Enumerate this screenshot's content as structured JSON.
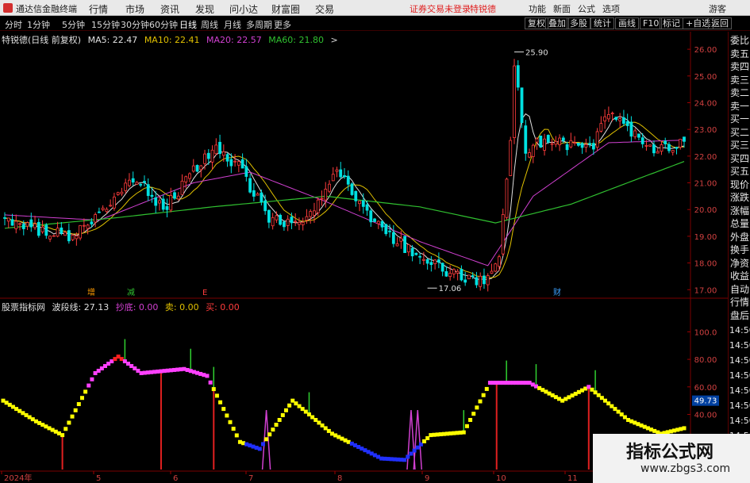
{
  "app": {
    "title": "通达信金融终端"
  },
  "menu": [
    "行情",
    "市场",
    "资讯",
    "发现",
    "问小达",
    "财富圈",
    "交易"
  ],
  "notice": {
    "text": "证券交易未登录",
    "link": "特锐德"
  },
  "toolbar_right": [
    "功能",
    "新面",
    "公式",
    "选项",
    "游客"
  ],
  "periods": [
    "分时",
    "1分钟",
    "5分钟",
    "15分钟",
    "30分钟",
    "60分钟",
    "日线",
    "周线",
    "月线",
    "多周期",
    "更多"
  ],
  "active_period": "日线",
  "tools": [
    "复权",
    "叠加",
    "多股",
    "统计",
    "画线",
    "F10",
    "标记",
    "+自选",
    "返回"
  ],
  "colors": {
    "up": "#ff3c3c",
    "down": "#00e0e0",
    "ma5": "#e0e0e0",
    "ma10": "#e0c000",
    "ma20": "#d040d0",
    "ma60": "#30c030"
  },
  "main_legend": {
    "name": "特锐德(日线 前复权)",
    "ma5": "MA5: 22.47",
    "ma10": "MA10: 22.41",
    "ma20": "MA20: 22.57",
    "ma60": "MA60: 21.80"
  },
  "sub_legend": {
    "name": "股票指标网",
    "wave": "波段线: 27.13",
    "bottom": "抄底: 0.00",
    "sell": "卖: 0.00",
    "sell2": "买: 0.00"
  },
  "price_axis": [
    "26.00",
    "25.00",
    "24.00",
    "23.00",
    "22.00",
    "21.00",
    "20.00",
    "19.00",
    "18.00",
    "17.00"
  ],
  "price_annotations": {
    "high": "25.90",
    "low": "17.06"
  },
  "chart_markers": [
    "增",
    "减",
    "E",
    "财"
  ],
  "sub_axis": [
    "100.0",
    "80.00",
    "60.00",
    "40.00"
  ],
  "sub_current": "49.73",
  "date_axis": [
    "2024年",
    "5",
    "6",
    "7",
    "8",
    "9",
    "10",
    "11"
  ],
  "side_labels": [
    "委比",
    "卖五",
    "卖四",
    "卖三",
    "卖二",
    "卖一",
    "买一",
    "买二",
    "买三",
    "买四",
    "买五",
    "现价",
    "涨跌",
    "涨幅",
    "总量",
    "外盘",
    "换手",
    "净资",
    "收益",
    "自动",
    "行情",
    "盘后"
  ],
  "side_times": [
    "14:50",
    "14:50",
    "14:50",
    "14:50",
    "14:50",
    "14:50",
    "14:50",
    "14:50"
  ],
  "watermark": {
    "title": "指标公式网",
    "url": "www.zbgs3.com"
  },
  "chart_data": [
    {
      "type": "candlestick",
      "ylim": [
        16.8,
        26.3
      ],
      "x": [
        0,
        180
      ],
      "key_points": [
        {
          "x": 0,
          "close": 19.6
        },
        {
          "x": 10,
          "close": 19.2
        },
        {
          "x": 18,
          "close": 19.0
        },
        {
          "x": 28,
          "close": 20.2
        },
        {
          "x": 35,
          "close": 21.2
        },
        {
          "x": 42,
          "close": 20.0
        },
        {
          "x": 50,
          "close": 21.5
        },
        {
          "x": 56,
          "close": 22.2
        },
        {
          "x": 62,
          "close": 21.6
        },
        {
          "x": 70,
          "close": 19.7
        },
        {
          "x": 78,
          "close": 19.4
        },
        {
          "x": 84,
          "close": 20.3
        },
        {
          "x": 88,
          "close": 21.6
        },
        {
          "x": 95,
          "close": 20.0
        },
        {
          "x": 103,
          "close": 18.9
        },
        {
          "x": 112,
          "close": 18.1
        },
        {
          "x": 118,
          "close": 17.6
        },
        {
          "x": 126,
          "close": 17.3
        },
        {
          "x": 131,
          "close": 18.0
        },
        {
          "x": 134,
          "close": 22.8
        },
        {
          "x": 135,
          "close": 25.4
        },
        {
          "x": 138,
          "close": 22.3
        },
        {
          "x": 145,
          "close": 22.6
        },
        {
          "x": 155,
          "close": 22.2
        },
        {
          "x": 160,
          "close": 23.7
        },
        {
          "x": 165,
          "close": 23.0
        },
        {
          "x": 172,
          "close": 22.1
        },
        {
          "x": 180,
          "close": 22.6
        }
      ],
      "ma60": [
        {
          "x": 0,
          "v": 19.3
        },
        {
          "x": 30,
          "v": 19.7
        },
        {
          "x": 55,
          "v": 20.1
        },
        {
          "x": 85,
          "v": 20.5
        },
        {
          "x": 110,
          "v": 20.1
        },
        {
          "x": 130,
          "v": 19.5
        },
        {
          "x": 150,
          "v": 20.2
        },
        {
          "x": 180,
          "v": 21.8
        }
      ],
      "ma20": [
        {
          "x": 0,
          "v": 19.8
        },
        {
          "x": 25,
          "v": 19.6
        },
        {
          "x": 50,
          "v": 21.0
        },
        {
          "x": 65,
          "v": 21.4
        },
        {
          "x": 85,
          "v": 20.3
        },
        {
          "x": 110,
          "v": 18.8
        },
        {
          "x": 128,
          "v": 17.9
        },
        {
          "x": 140,
          "v": 20.5
        },
        {
          "x": 160,
          "v": 22.5
        },
        {
          "x": 180,
          "v": 22.6
        }
      ]
    },
    {
      "type": "line",
      "ylim": [
        0,
        110
      ],
      "series": [
        {
          "name": "波段线",
          "values": [
            {
              "x": 0,
              "v": 50
            },
            {
              "x": 10,
              "v": 35
            },
            {
              "x": 18,
              "v": 25
            },
            {
              "x": 28,
              "v": 70
            },
            {
              "x": 35,
              "v": 82
            },
            {
              "x": 42,
              "v": 70
            },
            {
              "x": 55,
              "v": 73
            },
            {
              "x": 62,
              "v": 68
            },
            {
              "x": 72,
              "v": 20
            },
            {
              "x": 78,
              "v": 15
            },
            {
              "x": 88,
              "v": 50
            },
            {
              "x": 100,
              "v": 26
            },
            {
              "x": 115,
              "v": 8
            },
            {
              "x": 122,
              "v": 7
            },
            {
              "x": 130,
              "v": 25
            },
            {
              "x": 140,
              "v": 27
            },
            {
              "x": 148,
              "v": 63
            },
            {
              "x": 160,
              "v": 63
            },
            {
              "x": 170,
              "v": 50
            },
            {
              "x": 178,
              "v": 60
            },
            {
              "x": 190,
              "v": 36
            },
            {
              "x": 200,
              "v": 26
            },
            {
              "x": 207,
              "v": 30
            }
          ]
        }
      ]
    }
  ]
}
